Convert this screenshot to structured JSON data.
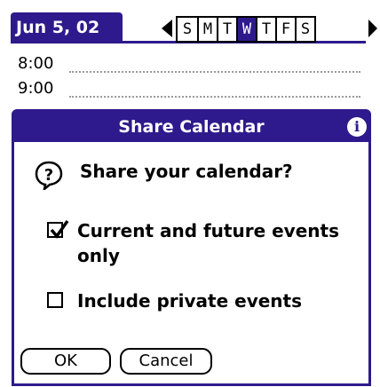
{
  "header": {
    "date": "Jun 5, 02",
    "weekdays": [
      {
        "label": "S",
        "active": false
      },
      {
        "label": "M",
        "active": false
      },
      {
        "label": "T",
        "active": false
      },
      {
        "label": "W",
        "active": true
      },
      {
        "label": "T",
        "active": false
      },
      {
        "label": "F",
        "active": false
      },
      {
        "label": "S",
        "active": false
      }
    ]
  },
  "timeslots": [
    "8:00",
    "9:00"
  ],
  "dialog": {
    "title": "Share Calendar",
    "info_icon": "i",
    "question": "Share your calendar?",
    "options": [
      {
        "label": "Current and future events only",
        "checked": true
      },
      {
        "label": "Include private events",
        "checked": false
      }
    ],
    "buttons": {
      "ok": "OK",
      "cancel": "Cancel"
    }
  },
  "icons": {
    "info": "info-icon",
    "question": "question-mark-icon",
    "prev": "left-arrow-icon",
    "next": "right-arrow-icon",
    "checkmark": "checkmark-icon"
  },
  "colors": {
    "accent": "#2e1a8c",
    "text": "#000000",
    "background": "#ffffff",
    "dotted_line": "#9a9a9a"
  }
}
